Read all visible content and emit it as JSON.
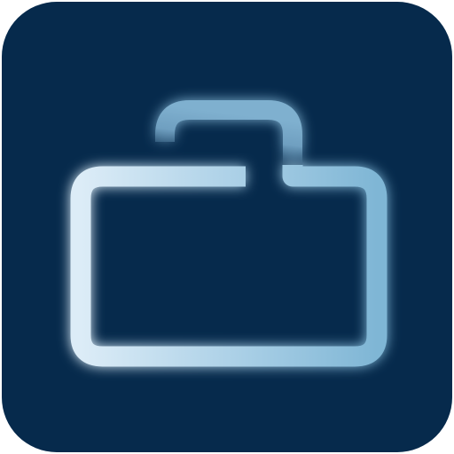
{
  "icon": {
    "name": "unlocked-folder-icon",
    "background_color": "#062a4c",
    "glyph_colors": {
      "left": "#dcecf7",
      "middle": "#a9cfe6",
      "right": "#7fb6d5",
      "shackle": "#6f9fc0"
    }
  }
}
